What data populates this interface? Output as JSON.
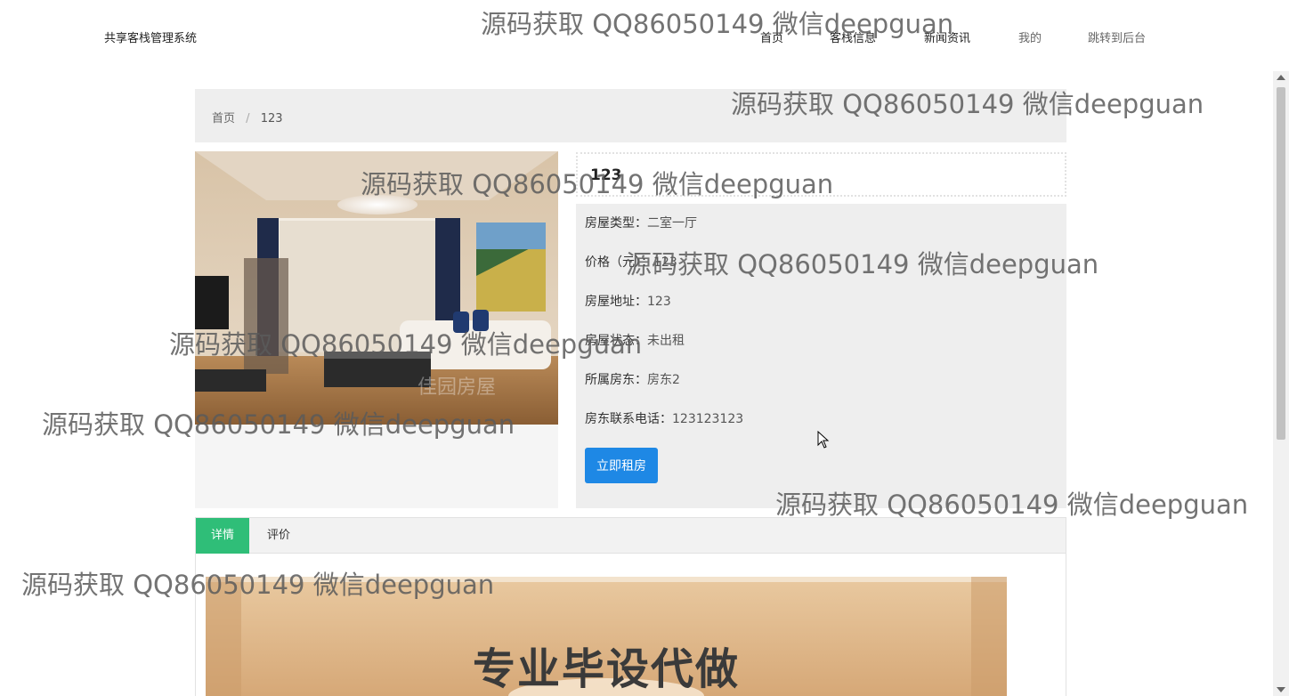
{
  "header": {
    "brand": "共享客栈管理系统",
    "nav": [
      {
        "label": "首页"
      },
      {
        "label": "客栈信息"
      },
      {
        "label": "新闻资讯"
      },
      {
        "label": "我的"
      },
      {
        "label": "跳转到后台"
      }
    ]
  },
  "breadcrumb": {
    "home": "首页",
    "separator": "/",
    "current": "123"
  },
  "listing": {
    "title": "123",
    "fields": [
      {
        "label": "房屋类型：",
        "value": "二室一厅"
      },
      {
        "label": "价格（元）：",
        "value": "123"
      },
      {
        "label": "房屋地址：",
        "value": "123"
      },
      {
        "label": "房屋状态：",
        "value": "未出租"
      },
      {
        "label": "所属房东：",
        "value": "房东2"
      },
      {
        "label": "房东联系电话：",
        "value": "123123123"
      }
    ],
    "rent_button": "立即租房",
    "photo_watermark": "佳园房屋"
  },
  "tabs": [
    {
      "label": "详情",
      "active": true
    },
    {
      "label": "评价",
      "active": false
    }
  ],
  "detail": {
    "banner_text": "专业毕设代做"
  },
  "watermark_text": "源码获取 QQ86050149 微信deepguan",
  "colors": {
    "accent_blue": "#1e88e5",
    "tab_green": "#2fbe78",
    "panel_gray": "#eeeeee"
  }
}
